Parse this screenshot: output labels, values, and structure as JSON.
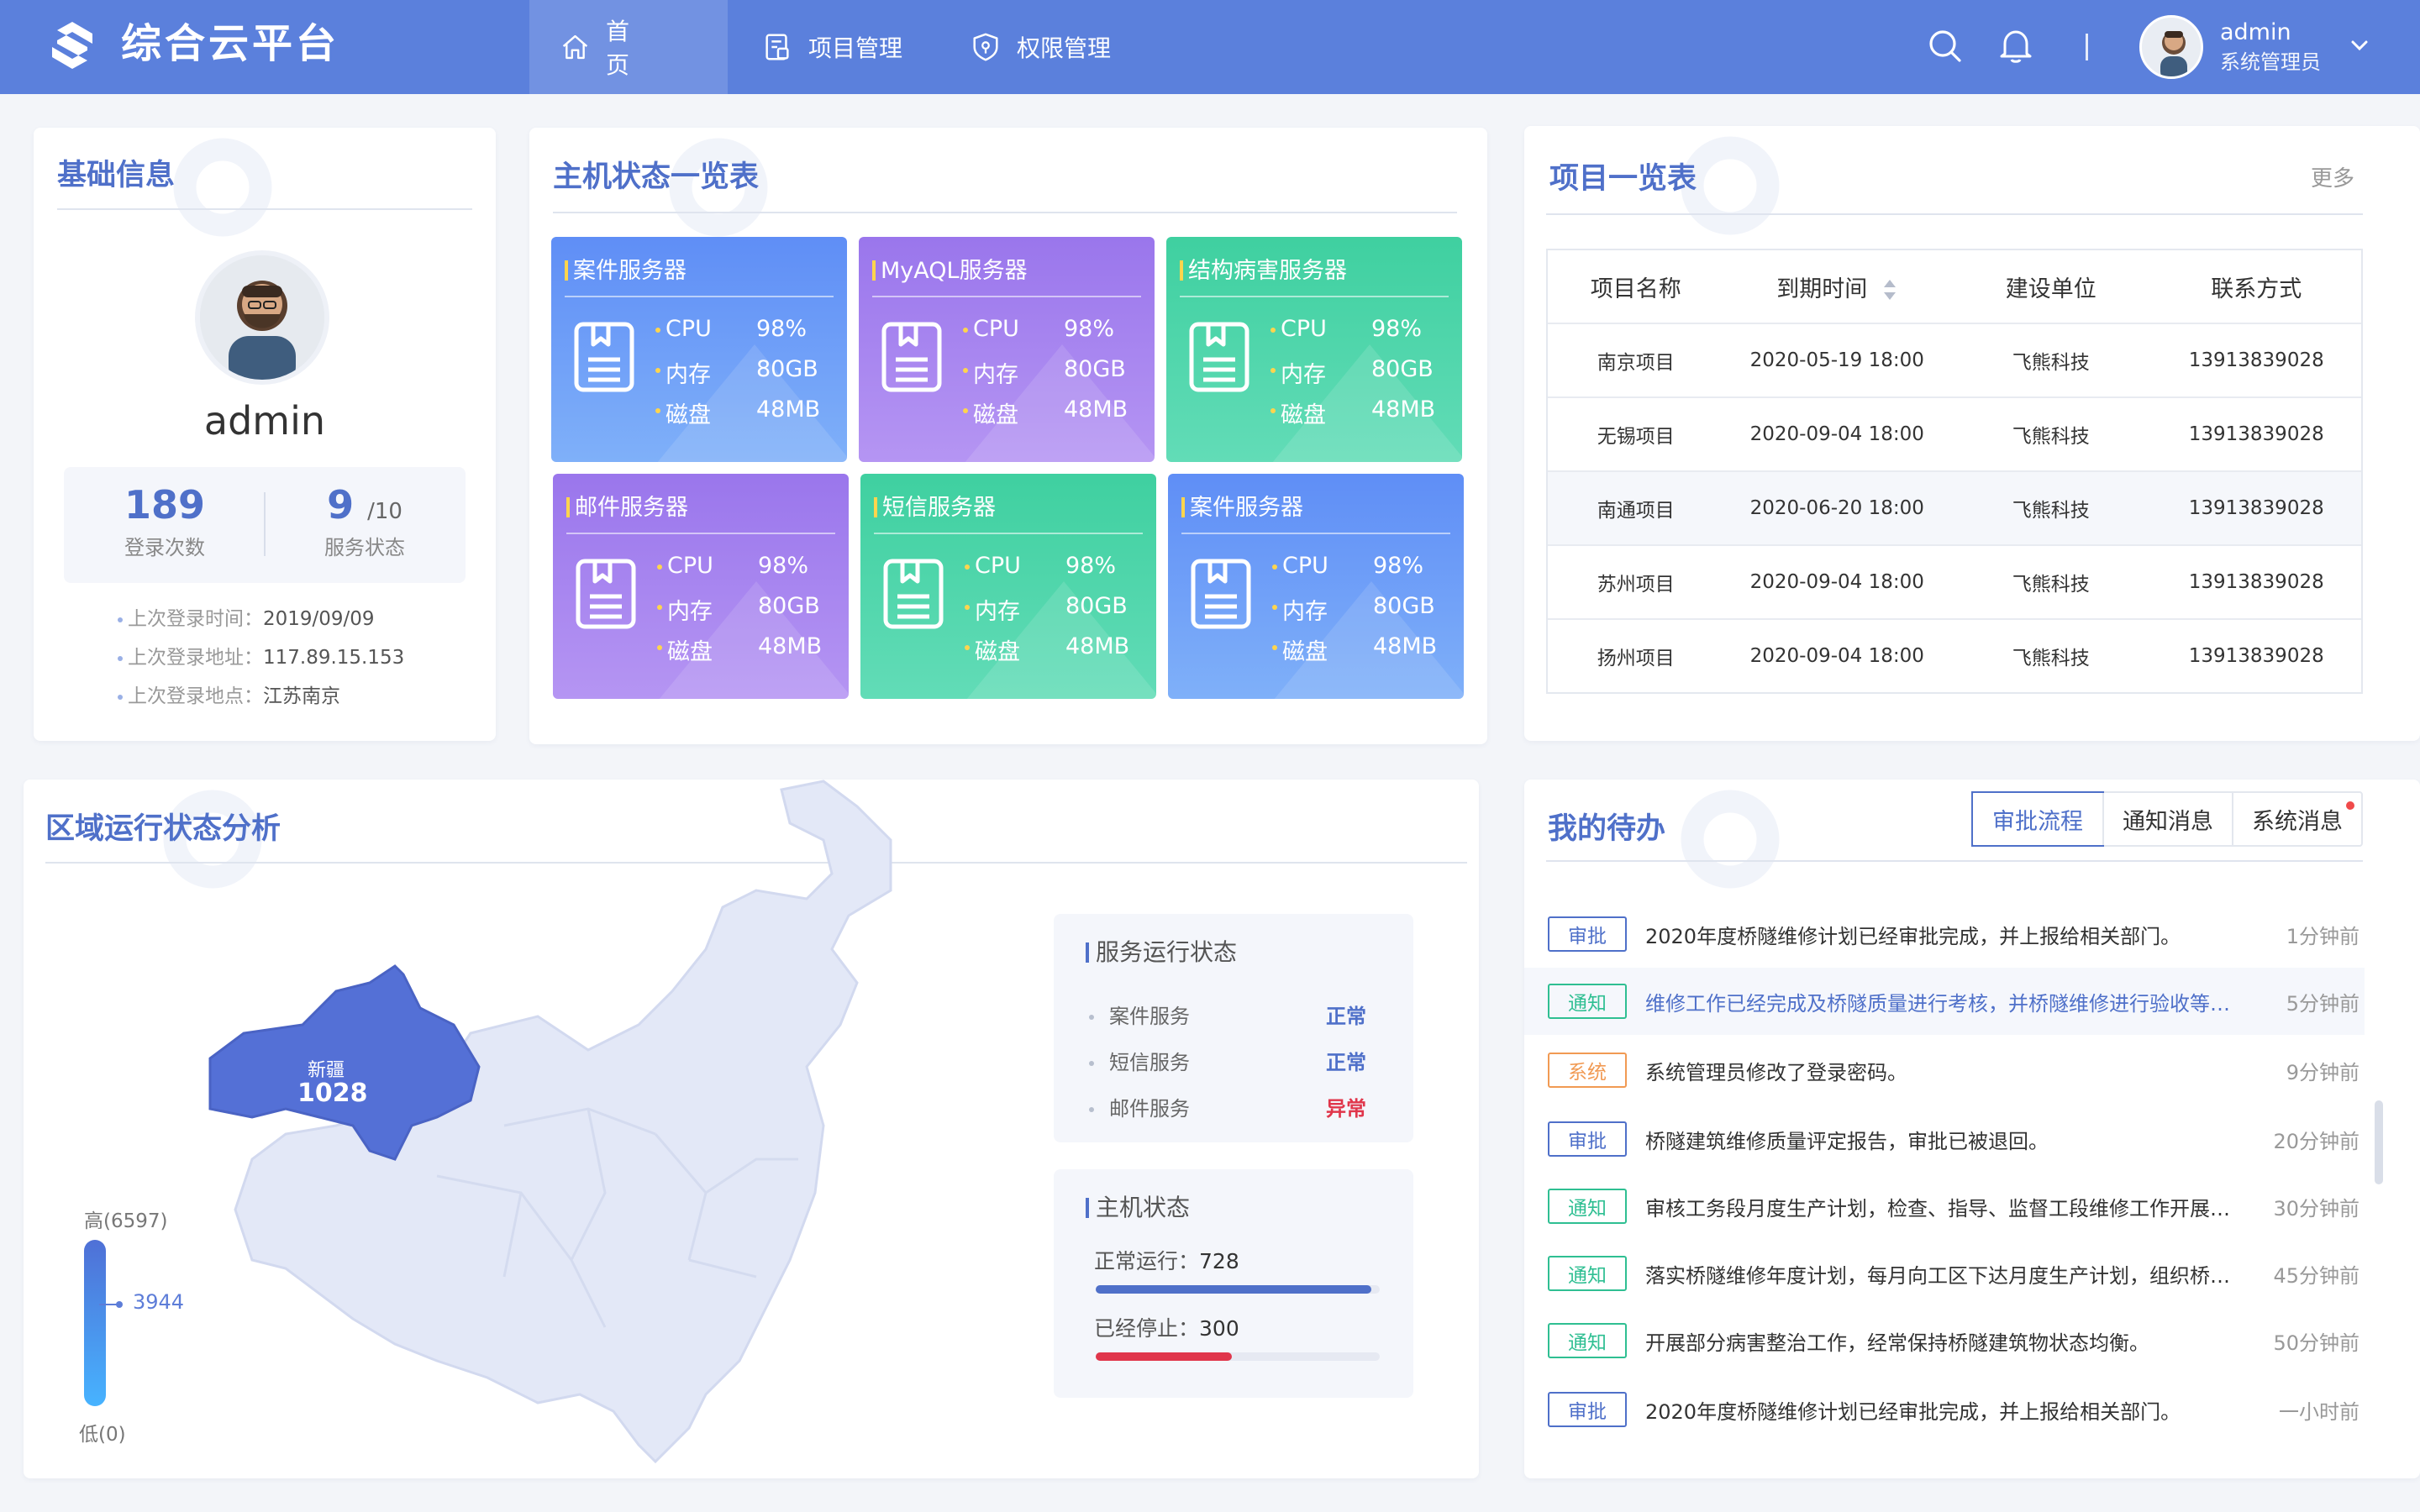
{
  "header": {
    "brand": "综合云平台",
    "nav": [
      {
        "label": "首页",
        "icon": "home-icon",
        "active": true
      },
      {
        "label": "项目管理",
        "icon": "project-icon"
      },
      {
        "label": "权限管理",
        "icon": "shield-icon"
      }
    ],
    "user": {
      "name": "admin",
      "role": "系统管理员"
    }
  },
  "basic": {
    "title": "基础信息",
    "username": "admin",
    "login_count": "189",
    "login_count_label": "登录次数",
    "service_num": "9",
    "service_total": "/10",
    "service_label": "服务状态",
    "last_login_time_label": "上次登录时间：",
    "last_login_time": "2019/09/09",
    "last_login_ip_label": "上次登录地址：",
    "last_login_ip": "117.89.15.153",
    "last_login_loc_label": "上次登录地点：",
    "last_login_loc": "江苏南京"
  },
  "hosts": {
    "title": "主机状态一览表",
    "cpu_label": "CPU",
    "mem_label": "内存",
    "disk_label": "磁盘",
    "servers": [
      {
        "name": "案件服务器",
        "cpu": "98%",
        "mem": "80GB",
        "disk": "48MB",
        "color": "blue"
      },
      {
        "name": "MyAQL服务器",
        "cpu": "98%",
        "mem": "80GB",
        "disk": "48MB",
        "color": "purple"
      },
      {
        "name": "结构病害服务器",
        "cpu": "98%",
        "mem": "80GB",
        "disk": "48MB",
        "color": "green"
      },
      {
        "name": "邮件服务器",
        "cpu": "98%",
        "mem": "80GB",
        "disk": "48MB",
        "color": "purple"
      },
      {
        "name": "短信服务器",
        "cpu": "98%",
        "mem": "80GB",
        "disk": "48MB",
        "color": "green"
      },
      {
        "name": "案件服务器",
        "cpu": "98%",
        "mem": "80GB",
        "disk": "48MB",
        "color": "blue"
      }
    ]
  },
  "projects": {
    "title": "项目一览表",
    "more": "更多",
    "columns": [
      "项目名称",
      "到期时间",
      "建设单位",
      "联系方式"
    ],
    "rows": [
      [
        "南京项目",
        "2020-05-19 18:00",
        "飞熊科技",
        "13913839028"
      ],
      [
        "无锡项目",
        "2020-09-04 18:00",
        "飞熊科技",
        "13913839028"
      ],
      [
        "南通项目",
        "2020-06-20 18:00",
        "飞熊科技",
        "13913839028"
      ],
      [
        "苏州项目",
        "2020-09-04 18:00",
        "飞熊科技",
        "13913839028"
      ],
      [
        "扬州项目",
        "2020-09-04 18:00",
        "飞熊科技",
        "13913839028"
      ]
    ]
  },
  "region": {
    "title": "区域运行状态分析",
    "highlight_name": "新疆",
    "highlight_value": "1028",
    "legend_high": "高(6597)",
    "legend_low": "低(0)",
    "legend_marker": "3944",
    "service_panel_title": "服务运行状态",
    "services": [
      {
        "name": "案件服务",
        "status": "正常",
        "color": "#4f70c9"
      },
      {
        "name": "短信服务",
        "status": "正常",
        "color": "#4f70c9"
      },
      {
        "name": "邮件服务",
        "status": "异常",
        "color": "#e0364b"
      }
    ],
    "host_panel_title": "主机状态",
    "running_label": "正常运行：",
    "running_value": "728",
    "running_ratio": 0.97,
    "stopped_label": "已经停止：",
    "stopped_value": "300",
    "stopped_ratio": 0.48
  },
  "todo": {
    "title": "我的待办",
    "tabs": [
      "审批流程",
      "通知消息",
      "系统消息"
    ],
    "items": [
      {
        "tag": "审批",
        "type": "approve",
        "text": "2020年度桥隧维修计划已经审批完成，并上报给相关部门。",
        "time": "1分钟前"
      },
      {
        "tag": "通知",
        "type": "notice",
        "text": "维修工作已经完成及桥隧质量进行考核，并桥隧维修进行验收等…",
        "time": "5分钟前"
      },
      {
        "tag": "系统",
        "type": "system",
        "text": "系统管理员修改了登录密码。",
        "time": "9分钟前"
      },
      {
        "tag": "审批",
        "type": "approve",
        "text": "桥隧建筑维修质量评定报告，审批已被退回。",
        "time": "20分钟前"
      },
      {
        "tag": "通知",
        "type": "notice",
        "text": "审核工务段月度生产计划，检查、指导、监督工段维修工作开展…",
        "time": "30分钟前"
      },
      {
        "tag": "通知",
        "type": "notice",
        "text": "落实桥隧维修年度计划，每月向工区下达月度生产计划，组织桥…",
        "time": "45分钟前"
      },
      {
        "tag": "通知",
        "type": "notice",
        "text": "开展部分病害整治工作，经常保持桥隧建筑物状态均衡。",
        "time": "50分钟前"
      },
      {
        "tag": "审批",
        "type": "approve",
        "text": "2020年度桥隧维修计划已经审批完成，并上报给相关部门。",
        "time": "一小时前"
      }
    ]
  }
}
